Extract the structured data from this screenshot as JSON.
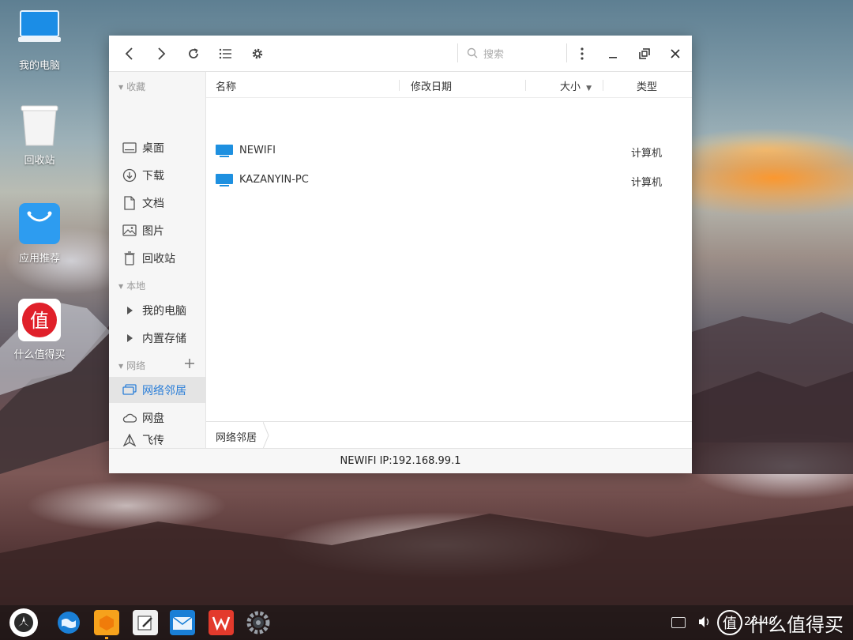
{
  "desktop": {
    "icons": [
      {
        "label": "我的电脑",
        "icon": "computer-icon"
      },
      {
        "label": "回收站",
        "icon": "trash-icon"
      },
      {
        "label": "应用推荐",
        "icon": "shopping-bag-icon"
      },
      {
        "label": "什么值得买",
        "icon": "smzdm-logo-icon",
        "logo_text": "值"
      }
    ]
  },
  "window": {
    "toolbar": {
      "search_placeholder": "搜索"
    },
    "sidebar": {
      "sections": [
        {
          "label": "收藏",
          "items": [
            "桌面",
            "下载",
            "文档",
            "图片",
            "回收站"
          ]
        },
        {
          "label": "本地",
          "items": [
            "我的电脑",
            "内置存储"
          ]
        },
        {
          "label": "网络",
          "items": [
            "网络邻居",
            "网盘",
            "飞传"
          ],
          "active": "网络邻居"
        }
      ]
    },
    "columns": {
      "name": "名称",
      "modified": "修改日期",
      "size": "大小",
      "type": "类型"
    },
    "rows": [
      {
        "name": "NEWIFI",
        "type": "计算机",
        "icon": "monitor-icon"
      },
      {
        "name": "KAZANYIN-PC",
        "type": "计算机",
        "icon": "monitor-icon"
      }
    ],
    "breadcrumb": "网络邻居",
    "status": "NEWIFI IP:192.168.99.1"
  },
  "taskbar": {
    "apps": [
      "launcher-icon",
      "browser-icon",
      "file-manager-icon",
      "notes-icon",
      "mail-icon",
      "wps-icon",
      "settings-icon"
    ],
    "tray_time": "23:40",
    "watermark": "什么值得买"
  },
  "colors": {
    "accent": "#2a7ed8",
    "monitor": "#1e90e0"
  }
}
